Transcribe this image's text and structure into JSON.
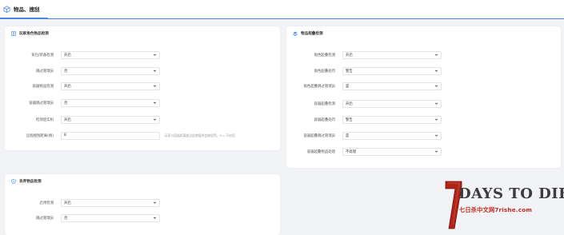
{
  "header": {
    "tab_label": "物品、搜刮"
  },
  "player_card": {
    "title": "玩家角色物品检测",
    "rows": [
      {
        "label": "背包/装备检测",
        "value": "开启"
      },
      {
        "label": "跳过管理员",
        "value": "否"
      },
      {
        "label": "容器物品检测",
        "value": "开启"
      },
      {
        "label": "容器跳过管理员",
        "value": "否"
      },
      {
        "label": "检测后实机",
        "value": "开启"
      },
      {
        "label": "远程搜刮距离(格)",
        "value": "8",
        "hint": "玩家与容器距离超过此数值将会被惩罚，0 = 不启用"
      }
    ]
  },
  "dropped_card": {
    "title": "丢弃物品检测",
    "rows": [
      {
        "label": "启用检测",
        "value": "开启"
      },
      {
        "label": "跳过管理员",
        "value": "否"
      }
    ]
  },
  "overflow_card": {
    "title": "物品超叠检测",
    "rows": [
      {
        "label": "角色超叠检测",
        "value": "开启"
      },
      {
        "label": "角色超叠处罚",
        "value": "警告"
      },
      {
        "label": "角色超叠跳过管理员",
        "value": "是"
      },
      {
        "label": "容器超叠检测",
        "value": "开启"
      },
      {
        "label": "容器超叠处罚",
        "value": "警告"
      },
      {
        "label": "容器超叠跳过管理员",
        "value": "是"
      },
      {
        "label": "容器超叠物品处理",
        "value": "不处理"
      }
    ]
  },
  "watermark": {
    "title": "DAYS TO DIE",
    "number": "7",
    "subtitle": "七日杀中文网7rishe.com"
  },
  "colors": {
    "accent": "#4a86e8",
    "watermark_red": "#c32a1e"
  }
}
